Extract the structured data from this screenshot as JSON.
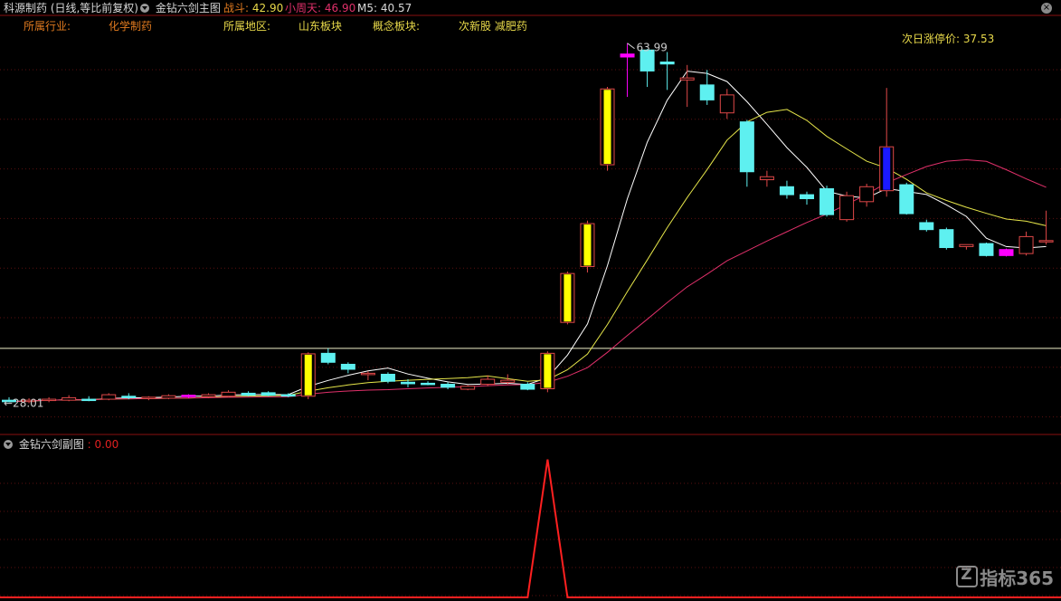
{
  "header": {
    "stock_title": "科源制药 (日线,等比前复权)",
    "main_indicator": "金钻六剑主图",
    "zhandou_label": "战斗:",
    "zhandou_value": "42.90",
    "xiaozhoutian_label": "小周天:",
    "xiaozhoutian_value": "46.90",
    "m5_label": "M5:",
    "m5_value": "40.57"
  },
  "info": {
    "industry_label": "所属行业:",
    "industry_value": "化学制药",
    "region_label": "所属地区:",
    "region_value": "山东板块",
    "concept_label": "概念板块:",
    "concept_value": "次新股 减肥药",
    "limit_label": "次日涨停价:",
    "limit_value": "37.53"
  },
  "sub_panel": {
    "title": "金钻六剑副图",
    "value": ": 0.00"
  },
  "watermark": "指标365",
  "colors": {
    "background": "#000000",
    "up_candle": "#e04848",
    "down_candle": "#5ef0f0",
    "signal_yellow": "#ffff00",
    "signal_magenta": "#ff00ff",
    "signal_blue": "#1a1aff",
    "ma_white": "#ffffff",
    "ma_yellow": "#e6e64a",
    "ma_pink": "#e0306a",
    "sub_line": "#ff2020",
    "grid": "#5a1010"
  },
  "chart_data": [
    {
      "type": "candlestick",
      "title": "金钻六剑主图",
      "annotations": {
        "high_label": "63.99",
        "low_label": "28.01",
        "horizontal_line": 33.4
      },
      "ylim": [
        26.4,
        66.5
      ],
      "candles": [
        {
          "o": 28.2,
          "h": 28.5,
          "l": 28.01,
          "c": 28.05
        },
        {
          "o": 28.1,
          "h": 28.4,
          "l": 27.9,
          "c": 28.2
        },
        {
          "o": 28.2,
          "h": 28.5,
          "l": 28.0,
          "c": 28.3
        },
        {
          "o": 28.2,
          "h": 28.7,
          "l": 28.1,
          "c": 28.45
        },
        {
          "o": 28.3,
          "h": 28.6,
          "l": 28.1,
          "c": 28.2
        },
        {
          "o": 28.3,
          "h": 28.9,
          "l": 28.2,
          "c": 28.75
        },
        {
          "o": 28.6,
          "h": 28.9,
          "l": 28.3,
          "c": 28.45
        },
        {
          "o": 28.4,
          "h": 28.6,
          "l": 28.2,
          "c": 28.5
        },
        {
          "o": 28.4,
          "h": 28.8,
          "l": 28.3,
          "c": 28.65
        },
        {
          "o": 28.55,
          "h": 28.8,
          "l": 28.4,
          "c": 28.7,
          "sig": "magenta"
        },
        {
          "o": 28.55,
          "h": 28.9,
          "l": 28.4,
          "c": 28.75
        },
        {
          "o": 28.6,
          "h": 29.2,
          "l": 28.5,
          "c": 29.0
        },
        {
          "o": 28.9,
          "h": 29.1,
          "l": 28.6,
          "c": 28.7
        },
        {
          "o": 28.95,
          "h": 29.1,
          "l": 28.6,
          "c": 28.7
        },
        {
          "o": 28.75,
          "h": 28.9,
          "l": 28.5,
          "c": 28.65
        },
        {
          "o": 28.6,
          "h": 33.0,
          "l": 28.3,
          "c": 32.85,
          "sig": "yellow"
        },
        {
          "o": 32.9,
          "h": 33.4,
          "l": 31.8,
          "c": 32.0
        },
        {
          "o": 31.8,
          "h": 32.0,
          "l": 30.9,
          "c": 31.3
        },
        {
          "o": 30.8,
          "h": 31.1,
          "l": 30.2,
          "c": 30.9
        },
        {
          "o": 30.8,
          "h": 31.0,
          "l": 29.9,
          "c": 30.1
        },
        {
          "o": 30.0,
          "h": 30.3,
          "l": 29.5,
          "c": 29.85
        },
        {
          "o": 29.9,
          "h": 30.1,
          "l": 29.7,
          "c": 29.85
        },
        {
          "o": 29.8,
          "h": 30.0,
          "l": 29.3,
          "c": 29.5
        },
        {
          "o": 29.3,
          "h": 29.7,
          "l": 29.2,
          "c": 29.6
        },
        {
          "o": 29.8,
          "h": 30.7,
          "l": 29.6,
          "c": 30.3
        },
        {
          "o": 30.0,
          "h": 30.8,
          "l": 29.8,
          "c": 30.2
        },
        {
          "o": 29.8,
          "h": 30.0,
          "l": 29.2,
          "c": 29.3
        },
        {
          "o": 29.35,
          "h": 33.1,
          "l": 29.0,
          "c": 32.9,
          "sig": "yellow"
        },
        {
          "o": 36.0,
          "h": 41.1,
          "l": 35.8,
          "c": 40.9,
          "sig": "yellow"
        },
        {
          "o": 41.6,
          "h": 46.2,
          "l": 41.0,
          "c": 45.9,
          "sig": "yellow"
        },
        {
          "o": 51.8,
          "h": 59.6,
          "l": 51.2,
          "c": 59.4,
          "sig": "yellow"
        },
        {
          "o": 62.6,
          "h": 63.99,
          "l": 58.6,
          "c": 62.9,
          "sig": "magenta"
        },
        {
          "o": 63.3,
          "h": 63.4,
          "l": 59.6,
          "c": 61.2
        },
        {
          "o": 62.1,
          "h": 63.1,
          "l": 59.3,
          "c": 61.9
        },
        {
          "o": 60.3,
          "h": 61.8,
          "l": 57.6,
          "c": 60.5
        },
        {
          "o": 59.8,
          "h": 61.3,
          "l": 57.8,
          "c": 58.3
        },
        {
          "o": 57.0,
          "h": 59.4,
          "l": 56.4,
          "c": 58.8
        },
        {
          "o": 56.1,
          "h": 56.3,
          "l": 49.6,
          "c": 51.1
        },
        {
          "o": 50.3,
          "h": 51.2,
          "l": 49.6,
          "c": 50.6
        },
        {
          "o": 49.6,
          "h": 50.2,
          "l": 48.4,
          "c": 48.8
        },
        {
          "o": 48.8,
          "h": 49.1,
          "l": 47.8,
          "c": 48.4
        },
        {
          "o": 49.4,
          "h": 49.7,
          "l": 46.6,
          "c": 46.8
        },
        {
          "o": 46.3,
          "h": 49.1,
          "l": 46.1,
          "c": 48.7
        },
        {
          "o": 48.1,
          "h": 49.9,
          "l": 47.6,
          "c": 49.6
        },
        {
          "o": 49.2,
          "h": 59.5,
          "l": 48.6,
          "c": 53.6,
          "sig": "blue"
        },
        {
          "o": 49.8,
          "h": 50.0,
          "l": 46.8,
          "c": 46.9
        },
        {
          "o": 46.0,
          "h": 46.3,
          "l": 45.1,
          "c": 45.3
        },
        {
          "o": 45.3,
          "h": 45.5,
          "l": 43.3,
          "c": 43.5
        },
        {
          "o": 43.6,
          "h": 43.8,
          "l": 43.3,
          "c": 43.8
        },
        {
          "o": 43.9,
          "h": 44.0,
          "l": 42.6,
          "c": 42.7
        },
        {
          "o": 43.3,
          "h": 43.4,
          "l": 42.6,
          "c": 42.7,
          "sig": "magenta"
        },
        {
          "o": 42.9,
          "h": 45.1,
          "l": 42.7,
          "c": 44.6
        },
        {
          "o": 44.1,
          "h": 47.2,
          "l": 43.8,
          "c": 44.2
        }
      ]
    },
    {
      "type": "line",
      "title": "金钻六剑副图",
      "ylim": [
        0,
        1.05
      ],
      "series": [
        {
          "values": [
            0,
            0,
            0,
            0,
            0,
            0,
            0,
            0,
            0,
            0,
            0,
            0,
            0,
            0,
            0,
            0,
            0,
            0,
            0,
            0,
            0,
            0,
            0,
            0,
            0,
            0,
            0,
            1,
            0,
            0,
            0,
            0,
            0,
            0,
            0,
            0,
            0,
            0,
            0,
            0,
            0,
            0,
            0,
            0,
            0,
            0,
            0,
            0,
            0,
            0,
            0,
            0,
            0
          ]
        }
      ]
    }
  ]
}
